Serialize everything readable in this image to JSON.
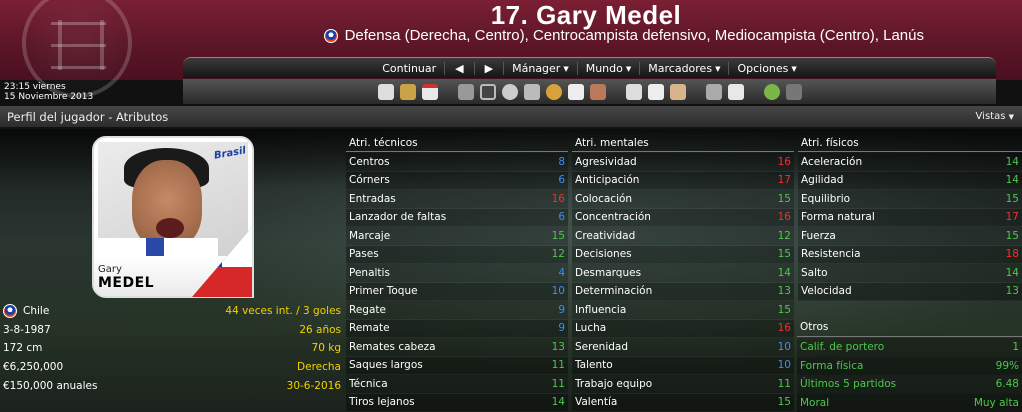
{
  "header": {
    "title": "17. Gary Medel",
    "subtitle": "Defensa (Derecha, Centro), Centrocampista defensivo, Mediocampista (Centro), Lanús"
  },
  "menu": {
    "continue": "Continuar",
    "back": "◀",
    "forward": "▶",
    "manager": "Mánager",
    "world": "Mundo",
    "scores": "Marcadores",
    "options": "Opciones"
  },
  "datetime": {
    "time_day": "23:15  viernes",
    "date": "15 Noviembre 2013"
  },
  "page": {
    "title": "Perfil del jugador - Atributos",
    "views": "Vistas"
  },
  "portrait": {
    "first": "Gary",
    "last": "MEDEL",
    "logo": "Brasil"
  },
  "info": [
    {
      "label": "Chile",
      "value": "44 veces int. / 3 goles"
    },
    {
      "label": "3-8-1987",
      "value": "26 años"
    },
    {
      "label": "172 cm",
      "value": "70 kg"
    },
    {
      "label": "€6,250,000",
      "value": "Derecha"
    },
    {
      "label": "€150,000 anuales",
      "value": "30-6-2016"
    }
  ],
  "technical": {
    "title": "Atri. técnicos",
    "items": [
      {
        "name": "Centros",
        "value": "8",
        "color": "blue"
      },
      {
        "name": "Córners",
        "value": "6",
        "color": "blue"
      },
      {
        "name": "Entradas",
        "value": "16",
        "color": "red"
      },
      {
        "name": "Lanzador de faltas",
        "value": "6",
        "color": "blue"
      },
      {
        "name": "Marcaje",
        "value": "15",
        "color": "green"
      },
      {
        "name": "Pases",
        "value": "12",
        "color": "green"
      },
      {
        "name": "Penaltis",
        "value": "4",
        "color": "blue"
      },
      {
        "name": "Primer Toque",
        "value": "10",
        "color": "blue"
      },
      {
        "name": "Regate",
        "value": "9",
        "color": "blue"
      },
      {
        "name": "Remate",
        "value": "9",
        "color": "blue"
      },
      {
        "name": "Remates cabeza",
        "value": "13",
        "color": "green"
      },
      {
        "name": "Saques largos",
        "value": "11",
        "color": "green"
      },
      {
        "name": "Técnica",
        "value": "11",
        "color": "green"
      },
      {
        "name": "Tiros lejanos",
        "value": "14",
        "color": "green"
      }
    ]
  },
  "mental": {
    "title": "Atri. mentales",
    "items": [
      {
        "name": "Agresividad",
        "value": "16",
        "color": "red"
      },
      {
        "name": "Anticipación",
        "value": "17",
        "color": "red"
      },
      {
        "name": "Colocación",
        "value": "15",
        "color": "green"
      },
      {
        "name": "Concentración",
        "value": "16",
        "color": "red"
      },
      {
        "name": "Creatividad",
        "value": "12",
        "color": "green"
      },
      {
        "name": "Decisiones",
        "value": "15",
        "color": "green"
      },
      {
        "name": "Desmarques",
        "value": "14",
        "color": "green"
      },
      {
        "name": "Determinación",
        "value": "13",
        "color": "green"
      },
      {
        "name": "Influencia",
        "value": "15",
        "color": "green"
      },
      {
        "name": "Lucha",
        "value": "16",
        "color": "red"
      },
      {
        "name": "Serenidad",
        "value": "10",
        "color": "blue"
      },
      {
        "name": "Talento",
        "value": "10",
        "color": "blue"
      },
      {
        "name": "Trabajo equipo",
        "value": "11",
        "color": "green"
      },
      {
        "name": "Valentía",
        "value": "15",
        "color": "green"
      }
    ]
  },
  "physical": {
    "title": "Atri. físicos",
    "items": [
      {
        "name": "Aceleración",
        "value": "14",
        "color": "green"
      },
      {
        "name": "Agilidad",
        "value": "14",
        "color": "green"
      },
      {
        "name": "Equilibrio",
        "value": "15",
        "color": "green"
      },
      {
        "name": "Forma natural",
        "value": "17",
        "color": "red"
      },
      {
        "name": "Fuerza",
        "value": "15",
        "color": "green"
      },
      {
        "name": "Resistencia",
        "value": "18",
        "color": "red"
      },
      {
        "name": "Salto",
        "value": "14",
        "color": "green"
      },
      {
        "name": "Velocidad",
        "value": "13",
        "color": "green"
      }
    ]
  },
  "other": {
    "title": "Otros",
    "items": [
      {
        "name": "Calif. de portero",
        "value": "1"
      },
      {
        "name": "Forma física",
        "value": "99%"
      },
      {
        "name": "Últimos 5 partidos",
        "value": "6.48"
      },
      {
        "name": "Moral",
        "value": "Muy alta"
      }
    ]
  },
  "colors": {
    "header_bg": "#5a1526",
    "value_blue": "#3b8ff0",
    "value_green": "#4cc84c",
    "value_red": "#ff2a2a",
    "info_yellow": "#f0d200"
  }
}
